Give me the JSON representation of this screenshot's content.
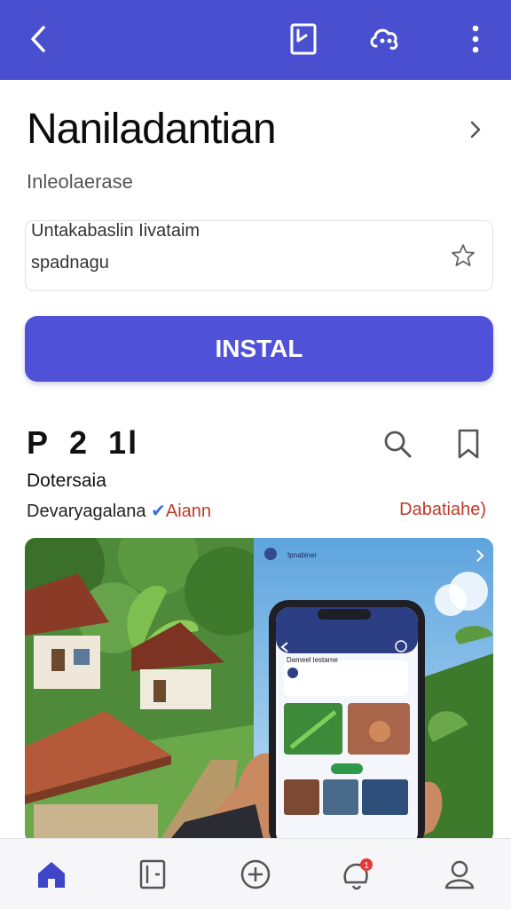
{
  "header": {
    "back_icon": "arrow-left-icon",
    "actions": [
      "bookmark-check-icon",
      "cloud-share-icon",
      "more-vert-icon"
    ]
  },
  "app": {
    "title": "Naniladantian",
    "subtitle": "Inleolaerase",
    "info_line1": "Untakabaslin Iivataim",
    "info_line2": "spadnagu",
    "install_label": "INSTAL"
  },
  "section": {
    "heading_parts": [
      "P",
      "2",
      "1l"
    ],
    "developer": "Dotersaia",
    "developer_sub": "Devaryagalana",
    "developer_tag": "Aiann",
    "developer_right": "Dabatiahe)"
  },
  "phone": {
    "screen_title": "Dameel lestame",
    "story_title": "Ipnabinei"
  },
  "bottom_nav": {
    "items": [
      "home-icon",
      "apps-icon",
      "add-icon",
      "notifications-icon",
      "profile-icon"
    ],
    "badge_count": "1"
  },
  "colors": {
    "appbar": "#4a4fcf",
    "install_button": "#4f52d9",
    "accent_red": "#c0392b",
    "verified": "#3b6fd8",
    "nav_active": "#3f45c9"
  }
}
